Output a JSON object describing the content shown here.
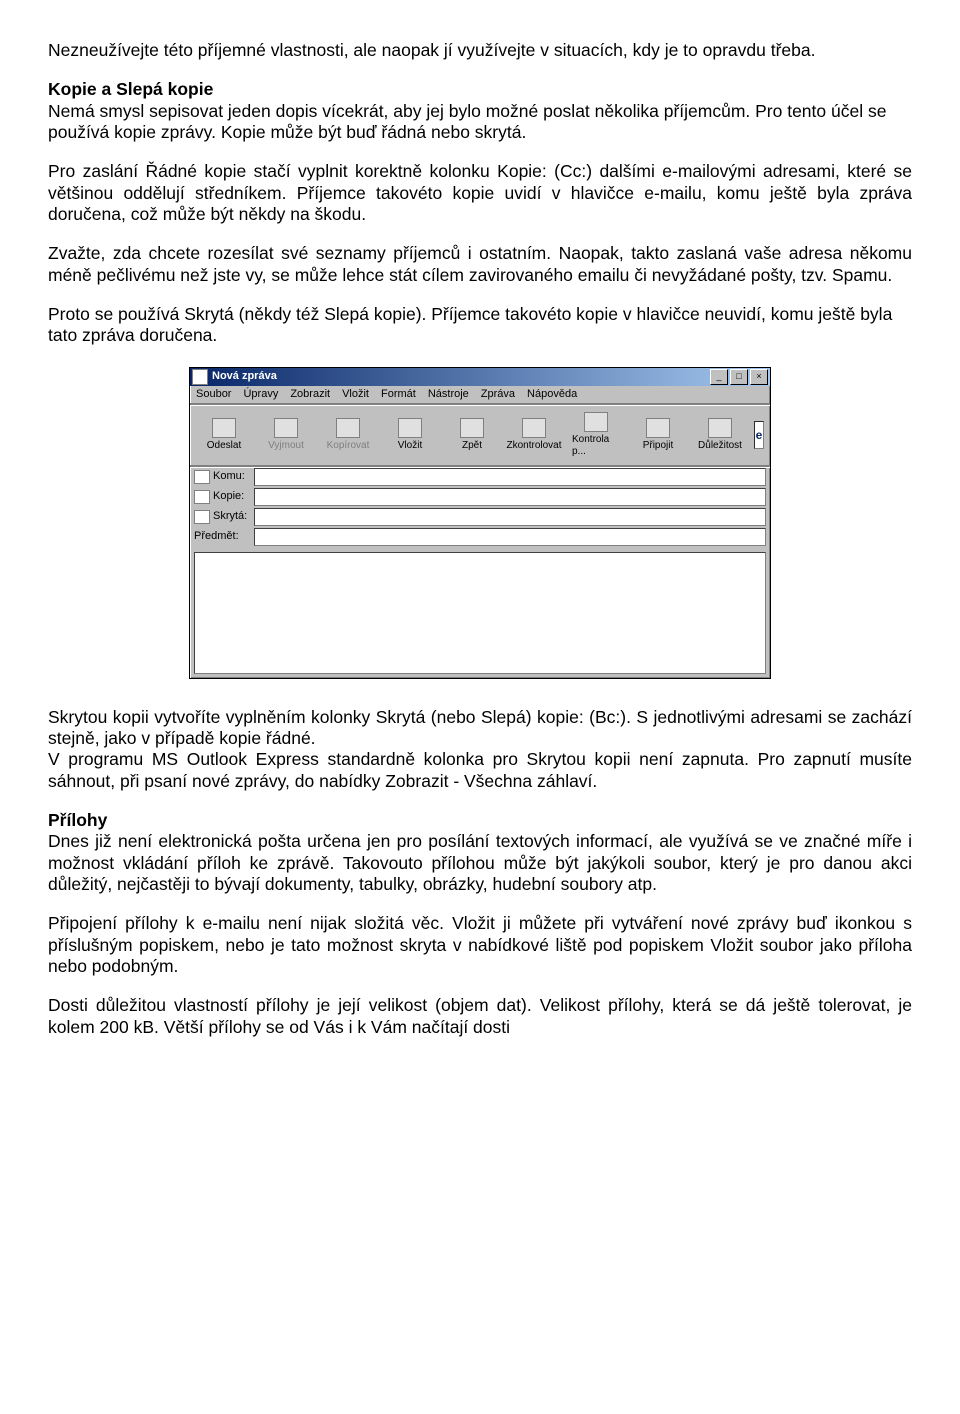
{
  "paragraphs": {
    "p1": "Nezneužívejte této příjemné vlastnosti, ale naopak jí využívejte v situacích, kdy je to opravdu třeba.",
    "h1": "Kopie a Slepá kopie",
    "p2": "Nemá smysl sepisovat jeden dopis vícekrát, aby jej bylo možné poslat několika příjemcům. Pro tento účel se používá kopie zprávy. Kopie může být buď řádná nebo skrytá.",
    "p3": "Pro zaslání Řádné kopie stačí vyplnit korektně kolonku Kopie: (Cc:) dalšími e-mailovými adresami, které se většinou oddělují středníkem. Příjemce takovéto kopie uvidí v hlavičce e-mailu, komu ještě byla zpráva doručena, což může být někdy na škodu.",
    "p4": "Zvažte, zda chcete rozesílat své seznamy příjemců i ostatním. Naopak, takto zaslaná vaše adresa někomu méně pečlivému než jste vy, se může lehce stát cílem zavirovaného emailu či nevyžádané pošty, tzv. Spamu.",
    "p5": "Proto se používá Skrytá (někdy též Slepá kopie). Příjemce takovéto kopie v hlavičce neuvidí, komu ještě byla tato zpráva doručena.",
    "p6a": "Skrytou kopii vytvoříte vyplněním kolonky Skrytá (nebo Slepá) kopie: (Bc:). S jednotlivými adresami se zachází stejně, jako v případě kopie řádné.",
    "p6b": "V programu MS Outlook Express standardně kolonka pro Skrytou kopii není zapnuta. Pro zapnutí musíte sáhnout, při psaní nové zprávy, do nabídky Zobrazit - Všechna záhlaví.",
    "h2": "Přílohy",
    "p7": "Dnes již není elektronická pošta určena jen pro posílání textových informací, ale využívá se ve značné míře i možnost vkládání příloh ke zprávě. Takovouto přílohou může být jakýkoli soubor, který je pro danou akci důležitý, nejčastěji to bývají dokumenty, tabulky, obrázky, hudební soubory atp.",
    "p8": "Připojení přílohy k e-mailu není nijak složitá věc. Vložit ji můžete při vytváření nové zprávy buď ikonkou s příslušným popiskem, nebo je tato možnost skryta v nabídkové liště pod popiskem Vložit soubor jako příloha nebo podobným.",
    "p9": "Dosti důležitou vlastností přílohy je její velikost (objem dat). Velikost přílohy, která se dá ještě tolerovat, je kolem 200 kB. Větší přílohy se od Vás i k Vám načítají dosti"
  },
  "window": {
    "title": "Nová zpráva",
    "menu": [
      "Soubor",
      "Úpravy",
      "Zobrazit",
      "Vložit",
      "Formát",
      "Nástroje",
      "Zpráva",
      "Nápověda"
    ],
    "toolbar": [
      {
        "label": "Odeslat",
        "disabled": false
      },
      {
        "label": "Vyjmout",
        "disabled": true
      },
      {
        "label": "Kopírovat",
        "disabled": true
      },
      {
        "label": "Vložit",
        "disabled": false
      },
      {
        "label": "Zpět",
        "disabled": false
      },
      {
        "label": "Zkontrolovat",
        "disabled": false
      },
      {
        "label": "Kontrola p...",
        "disabled": false
      },
      {
        "label": "Připojit",
        "disabled": false
      },
      {
        "label": "Důležitost",
        "disabled": false
      }
    ],
    "fields": {
      "to": "Komu:",
      "cc": "Kopie:",
      "bcc": "Skrytá:",
      "subj": "Předmět:"
    },
    "logo": "e"
  }
}
